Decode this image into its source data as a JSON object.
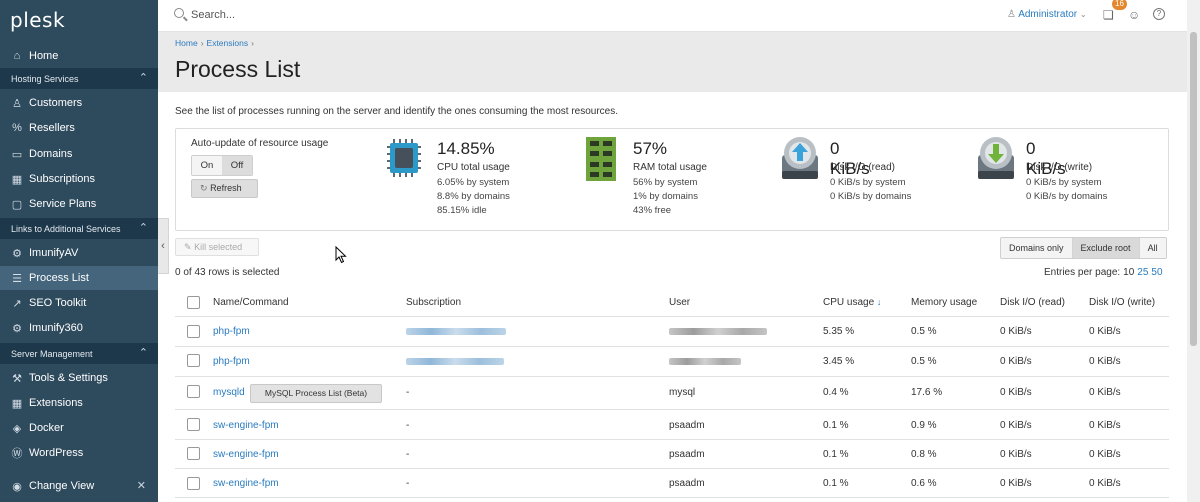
{
  "app": {
    "logo": "plesk"
  },
  "sidebar": {
    "home": "Home",
    "hosting_header": "Hosting Services",
    "hosting_items": [
      "Customers",
      "Resellers",
      "Domains",
      "Subscriptions",
      "Service Plans"
    ],
    "links_header": "Links to Additional Services",
    "links_items": [
      "ImunifyAV",
      "Process List",
      "SEO Toolkit",
      "Imunify360"
    ],
    "server_header": "Server Management",
    "server_items": [
      "Tools & Settings",
      "Extensions",
      "Docker",
      "WordPress"
    ],
    "change_view": "Change View"
  },
  "topbar": {
    "search_placeholder": "Search...",
    "user": "Administrator",
    "notifications_count": "16"
  },
  "breadcrumb": [
    "Home",
    "Extensions"
  ],
  "page_title": "Process List",
  "description": "See the list of processes running on the server and identify the ones consuming the most resources.",
  "resource_panel": {
    "auto_update_label": "Auto-update of resource usage",
    "toggle_on": "On",
    "toggle_off": "Off",
    "refresh": "Refresh",
    "cpu": {
      "value": "14.85%",
      "label": "CPU total usage",
      "lines": [
        "6.05% by system",
        "8.8% by domains",
        "85.15% idle"
      ]
    },
    "ram": {
      "value": "57%",
      "label": "RAM total usage",
      "lines": [
        "56% by system",
        "1% by domains",
        "43% free"
      ]
    },
    "disk_read": {
      "value": "0 KiB/s",
      "label": "Disk I/O (read)",
      "lines": [
        "0 KiB/s by system",
        "0 KiB/s by domains"
      ]
    },
    "disk_write": {
      "value": "0 KiB/s",
      "label": "Disk I/O (write)",
      "lines": [
        "0 KiB/s by system",
        "0 KiB/s by domains"
      ]
    }
  },
  "toolbar": {
    "kill_selected": "Kill selected",
    "filters": [
      "Domains only",
      "Exclude root",
      "All"
    ],
    "active_filter": "Exclude root",
    "rows_selected": "0 of 43 rows is selected",
    "entries_label": "Entries per page:",
    "entries_options": [
      "10",
      "25",
      "50"
    ]
  },
  "table": {
    "headers": [
      "Name/Command",
      "Subscription",
      "User",
      "CPU usage",
      "Memory usage",
      "Disk I/O (read)",
      "Disk I/O (write)"
    ],
    "sort_arrow": "↓",
    "mysql_button": "MySQL Process List (Beta)",
    "rows": [
      {
        "name": "php-fpm",
        "subscription": "",
        "user": "",
        "cpu": "5.35 %",
        "mem": "0.5 %",
        "read": "0 KiB/s",
        "write": "0 KiB/s"
      },
      {
        "name": "php-fpm",
        "subscription": "",
        "user": "",
        "cpu": "3.45 %",
        "mem": "0.5 %",
        "read": "0 KiB/s",
        "write": "0 KiB/s"
      },
      {
        "name": "mysqld",
        "subscription": "-",
        "user": "mysql",
        "cpu": "0.4 %",
        "mem": "17.6 %",
        "read": "0 KiB/s",
        "write": "0 KiB/s"
      },
      {
        "name": "sw-engine-fpm",
        "subscription": "-",
        "user": "psaadm",
        "cpu": "0.1 %",
        "mem": "0.9 %",
        "read": "0 KiB/s",
        "write": "0 KiB/s"
      },
      {
        "name": "sw-engine-fpm",
        "subscription": "-",
        "user": "psaadm",
        "cpu": "0.1 %",
        "mem": "0.8 %",
        "read": "0 KiB/s",
        "write": "0 KiB/s"
      },
      {
        "name": "sw-engine-fpm",
        "subscription": "-",
        "user": "psaadm",
        "cpu": "0.1 %",
        "mem": "0.6 %",
        "read": "0 KiB/s",
        "write": "0 KiB/s"
      }
    ]
  }
}
